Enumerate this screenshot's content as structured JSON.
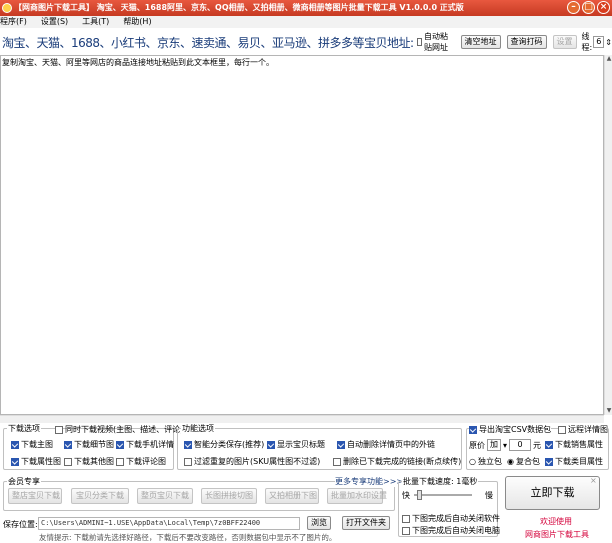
{
  "window": {
    "title": "【网商图片下载工具】 淘宝、天猫、1688阿里、京东、QQ相册、又拍相册、微商相册等图片批量下载工具 V1.0.0.0 正式版"
  },
  "menu": {
    "items": [
      "程序(F)",
      "设置(S)",
      "工具(T)",
      "帮助(H)"
    ]
  },
  "urlbar": {
    "label": "淘宝、天猫、1688、小红书、京东、速卖通、易贝、亚马逊、拼多多等宝贝地址:",
    "auto_paste_label": "自动粘贴网址",
    "clear_button": "清空地址",
    "query_button": "查询打码",
    "settings_button": "设置",
    "threads_label": "线程:",
    "threads_value": "6"
  },
  "textarea": {
    "placeholder": "复制淘宝、天猫、阿里等网店的商品连接地址粘贴到此文本框里，每行一个。"
  },
  "download_options": {
    "title": "下载选项",
    "sync_label": "同时下载视频(主图、描述、评论)",
    "items": [
      {
        "label": "下载主图",
        "checked": true
      },
      {
        "label": "下载细节图",
        "checked": true
      },
      {
        "label": "下载手机详情",
        "checked": true
      },
      {
        "label": "下载属性图",
        "checked": true
      },
      {
        "label": "下载其他图",
        "checked": false
      },
      {
        "label": "下载评论图",
        "checked": false
      }
    ]
  },
  "function_options": {
    "title": "功能选项",
    "items": [
      {
        "label": "智能分类保存(推荐)",
        "checked": true
      },
      {
        "label": "显示宝贝标题",
        "checked": true
      },
      {
        "label": "自动删除详情页中的外链",
        "checked": true
      },
      {
        "label": "过滤重复的图片(SKU属性图不过滤)",
        "checked": false
      },
      {
        "label": "删除已下载完成的链接(断点续传)",
        "checked": false
      }
    ]
  },
  "right_options": {
    "export_csv": {
      "label": "导出淘宝CSV数据包",
      "checked": true
    },
    "remote_detail": {
      "label": "远程详情图",
      "checked": false
    },
    "price_label": "原价",
    "price_op": "加",
    "price_value": "0",
    "price_unit": "元",
    "sales_attr": {
      "label": "下载销售属性",
      "checked": true
    },
    "pkg_mode": [
      "独立包",
      "复合包"
    ],
    "pkg_selected": 1,
    "category_attr": {
      "label": "下载类目属性",
      "checked": true
    }
  },
  "member": {
    "title": "会员专享",
    "more_link": "更多专享功能>>>",
    "buttons": [
      "整店宝贝下载",
      "宝贝分类下载",
      "整页宝贝下载",
      "长图拼接切图",
      "又拍相册下图",
      "批量加水印设置"
    ]
  },
  "save": {
    "label": "保存位置:",
    "path": "C:\\Users\\ADMINI~1.USE\\AppData\\Local\\Temp\\7z0BFF22400",
    "browse_button": "浏览",
    "open_folder_button": "打开文件夹",
    "hint": "友情提示: 下载前请先选择好路径，下载后不要改变路径，否则数据包中显示不了图片的。"
  },
  "speed": {
    "title": "批量下载速度: 1毫秒",
    "fast": "快",
    "slow": "慢",
    "close_after": {
      "label": "下图完成后自动关闭软件",
      "checked": false
    },
    "shutdown_after": {
      "label": "下图完成后自动关闭电脑",
      "checked": false
    },
    "level": 0.05
  },
  "start_button": "立即下载",
  "welcome_text": "欢迎使用",
  "brand_text": "网商图片下载工具",
  "colors": {
    "title_bar": "#d8462c",
    "url_label": "#1a3c7a",
    "brand_red": "#d4003a"
  }
}
